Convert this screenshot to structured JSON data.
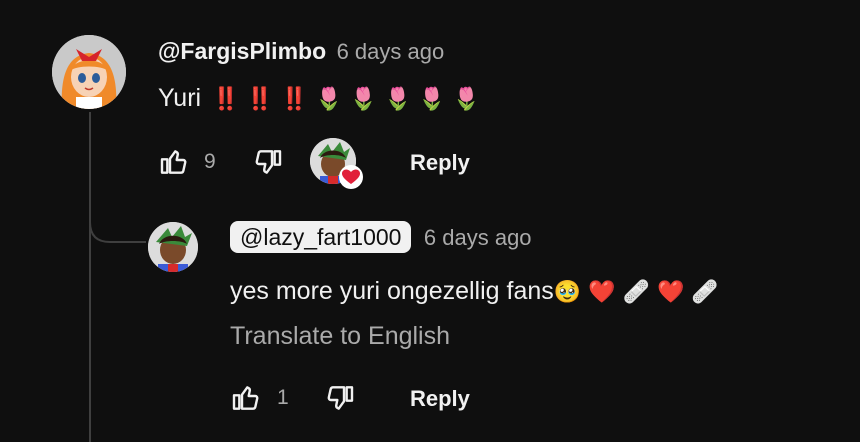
{
  "comment": {
    "author": "@FargisPlimbo",
    "time": "6 days ago",
    "text_prefix": "Yuri",
    "text_emoji": "‼️ ‼️ ‼️ 🌷 🌷 🌷 🌷 🌷",
    "likes": "9",
    "reply_label": "Reply"
  },
  "reply": {
    "author": "@lazy_fart1000",
    "time": "6 days ago",
    "text_prefix": "yes more yuri ongezellig fans",
    "text_emoji": "🥹 ❤️ 🩹 ❤️ 🩹",
    "translate_label": "Translate to English",
    "likes": "1",
    "reply_label": "Reply"
  },
  "colors": {
    "background": "#0f0f0f",
    "primary_text": "#f1f1f1",
    "secondary_text": "#aaaaaa",
    "heart": "#e1203a"
  },
  "icons": [
    "thumbs-up-icon",
    "thumbs-down-icon",
    "creator-heart-icon"
  ]
}
